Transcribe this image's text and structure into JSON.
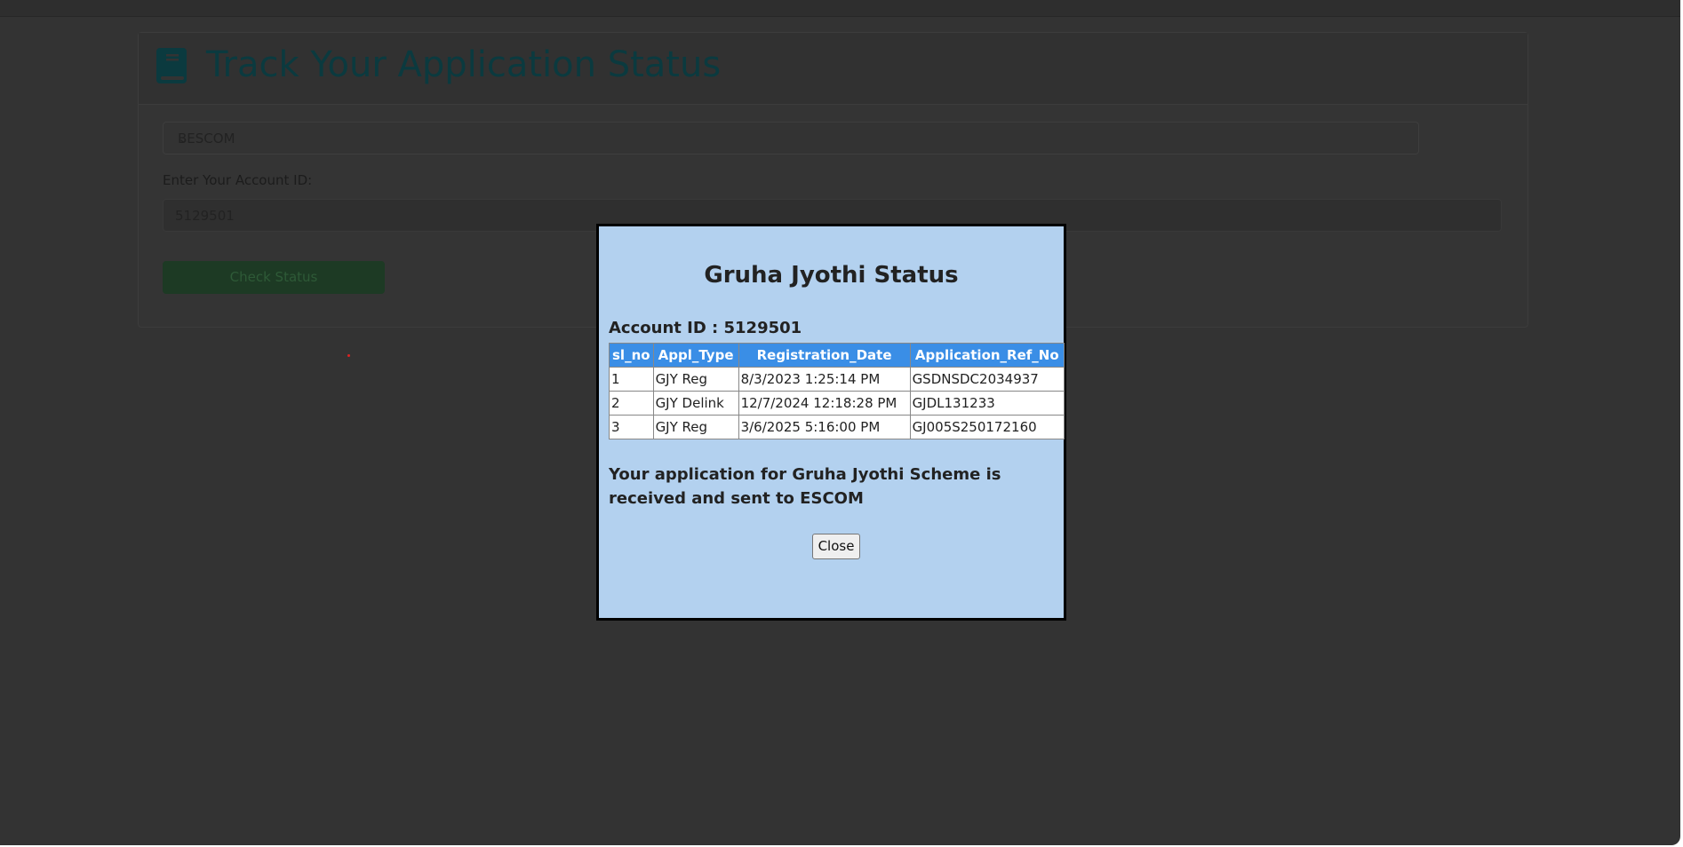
{
  "page": {
    "title": "Track Your Application Status",
    "escom_select": {
      "selected": "BESCOM"
    },
    "account_label": "Enter Your Account ID:",
    "account_value": "5129501",
    "check_button": "Check Status"
  },
  "modal": {
    "title": "Gruha Jyothi Status",
    "account_line": "Account ID : 5129501",
    "columns": [
      "sl_no",
      "Appl_Type",
      "Registration_Date",
      "Application_Ref_No"
    ],
    "rows": [
      [
        "1",
        "GJY Reg",
        "8/3/2023 1:25:14 PM",
        "GSDNSDC2034937"
      ],
      [
        "2",
        "GJY Delink",
        "12/7/2024 12:18:28 PM",
        "GJDL131233"
      ],
      [
        "3",
        "GJY Reg",
        "3/6/2025 5:16:00 PM",
        "GJ005S250172160"
      ]
    ],
    "message": "Your application for Gruha Jyothi Scheme is received and sent to ESCOM",
    "close_label": "Close"
  },
  "colors": {
    "modal_bg": "#b3d1ef",
    "table_header": "#3a8ee6",
    "title": "#0b3a3f"
  }
}
